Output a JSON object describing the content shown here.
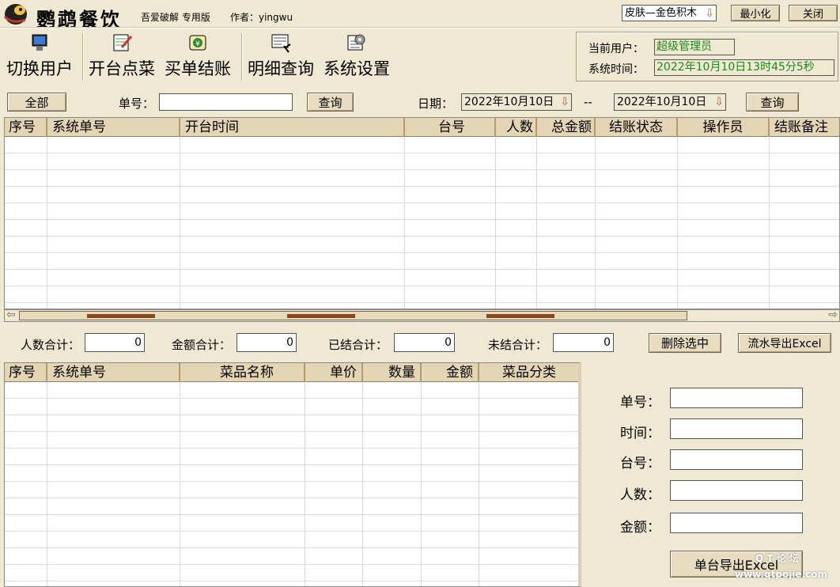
{
  "app": {
    "title": "鹦鹉餐饮",
    "subtitle": "吾爱破解 专用版",
    "author": "作者：yingwu"
  },
  "titlebar": {
    "skin": "皮肤—金色积木",
    "minimize": "最小化",
    "close": "关闭"
  },
  "toolbar": {
    "switch_user": "切换用户",
    "open_order": "开台点菜",
    "checkout": "买单结账",
    "detail_query": "明细查询",
    "settings": "系统设置"
  },
  "status": {
    "user_label": "当前用户：",
    "user_value": "超级管理员",
    "time_label": "系统时间：",
    "time_value": "2022年10月10日13时45分5秒"
  },
  "filter": {
    "all": "全部",
    "order_label": "单号：",
    "order_value": "",
    "query1": "查询",
    "date_label": "日期：",
    "date_from": "2022年10月10日",
    "date_sep": "--",
    "date_to": "2022年10月10日",
    "query2": "查询"
  },
  "orders_table": {
    "headers": [
      "序号",
      "系统单号",
      "开台时间",
      "台号",
      "人数",
      "总金额",
      "结账状态",
      "操作员",
      "结账备注"
    ]
  },
  "totals": {
    "people_label": "人数合计：",
    "people_value": "0",
    "amount_label": "金额合计：",
    "amount_value": "0",
    "settled_label": "已结合计：",
    "settled_value": "0",
    "unsettled_label": "未结合计：",
    "unsettled_value": "0",
    "delete_selected": "删除选中",
    "export_flow": "流水导出Excel"
  },
  "items_table": {
    "headers": [
      "序号",
      "系统单号",
      "菜品名称",
      "单价",
      "数量",
      "金额",
      "菜品分类"
    ]
  },
  "detail": {
    "order_label": "单号：",
    "time_label": "时间：",
    "table_label": "台号：",
    "people_label": "人数：",
    "amount_label": "金额：",
    "export_single": "单台导出Excel"
  },
  "watermark": {
    "line1": "Q T 论 坛",
    "line2": "www.qtpojie.com"
  }
}
